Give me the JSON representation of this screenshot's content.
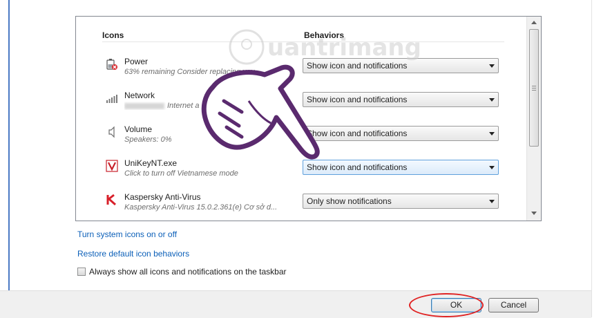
{
  "columns": {
    "icons": "Icons",
    "behaviors": "Behaviors"
  },
  "rows": [
    {
      "name": "Power",
      "desc": "63% remaining  Consider replacing you",
      "behavior": "Show icon and notifications",
      "icon": "battery-icon"
    },
    {
      "name": "Network",
      "desc": "Internet a",
      "behavior": "Show icon and notifications",
      "icon": "network-signal-icon"
    },
    {
      "name": "Volume",
      "desc": "Speakers: 0%",
      "behavior": "Show icon and notifications",
      "icon": "speaker-icon"
    },
    {
      "name": "UniKeyNT.exe",
      "desc": "Click to turn off Vietnamese mode",
      "behavior": "Show icon and notifications",
      "icon": "unikey-v-icon"
    },
    {
      "name": "Kaspersky Anti-Virus",
      "desc": "Kaspersky Anti-Virus 15.0.2.361(e) Cơ sở d...",
      "behavior": "Only show notifications",
      "icon": "kaspersky-k-icon"
    }
  ],
  "links": {
    "system_icons": "Turn system icons on or off",
    "restore_defaults": "Restore default icon behaviors"
  },
  "always_show": {
    "label": "Always show all icons and notifications on the taskbar",
    "checked": false
  },
  "buttons": {
    "ok": "OK",
    "cancel": "Cancel"
  },
  "watermark": {
    "text": "Quantrimang"
  },
  "colors": {
    "link": "#0b5fb8",
    "highlight_circle": "#e02222",
    "hand": "#5a2a6e"
  }
}
